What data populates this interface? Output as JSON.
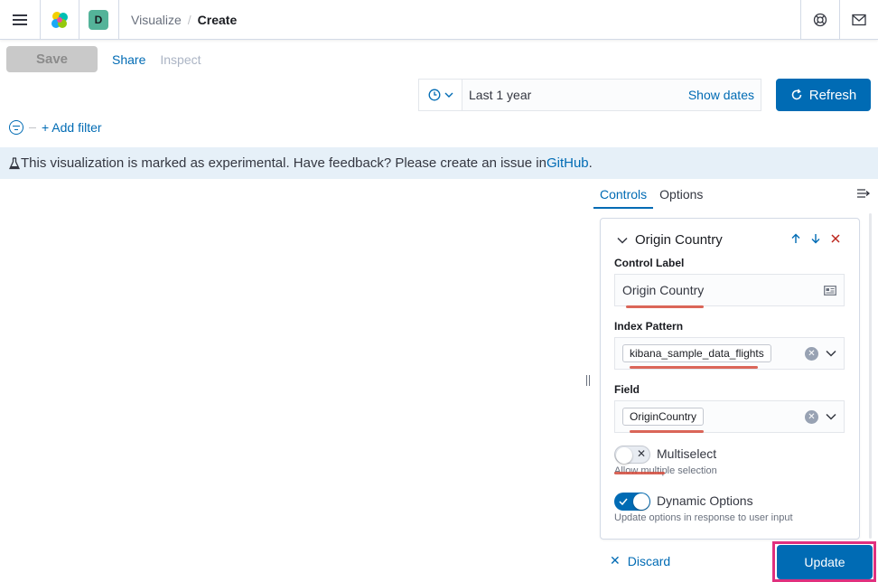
{
  "header": {
    "breadcrumbs": [
      "Visualize",
      "/",
      "Create"
    ],
    "space_initial": "D"
  },
  "menu": {
    "save": "Save",
    "share": "Share",
    "inspect": "Inspect"
  },
  "datepicker": {
    "range": "Last 1 year",
    "show_dates": "Show dates",
    "refresh": "Refresh"
  },
  "filter": {
    "add": "+ Add filter"
  },
  "callout": {
    "text": "This visualization is marked as experimental. Have feedback? Please create an issue in ",
    "link": "GitHub",
    "tail": "."
  },
  "editor": {
    "tabs": [
      "Controls",
      "Options"
    ],
    "control_title": "Origin Country",
    "control_label_label": "Control Label",
    "control_label_value": "Origin Country",
    "index_pattern_label": "Index Pattern",
    "index_pattern_value": "kibana_sample_data_flights",
    "field_label": "Field",
    "field_value": "OriginCountry",
    "multiselect_label": "Multiselect",
    "multiselect_help": "Allow multiple selection",
    "multiselect_enabled": false,
    "dynamic_label": "Dynamic Options",
    "dynamic_help": "Update options in response to user input",
    "dynamic_enabled": true,
    "discard": "Discard",
    "update": "Update"
  },
  "colors": {
    "primary": "#006bb4",
    "annotation": "#d54b3c",
    "highlight": "#e0307e"
  }
}
